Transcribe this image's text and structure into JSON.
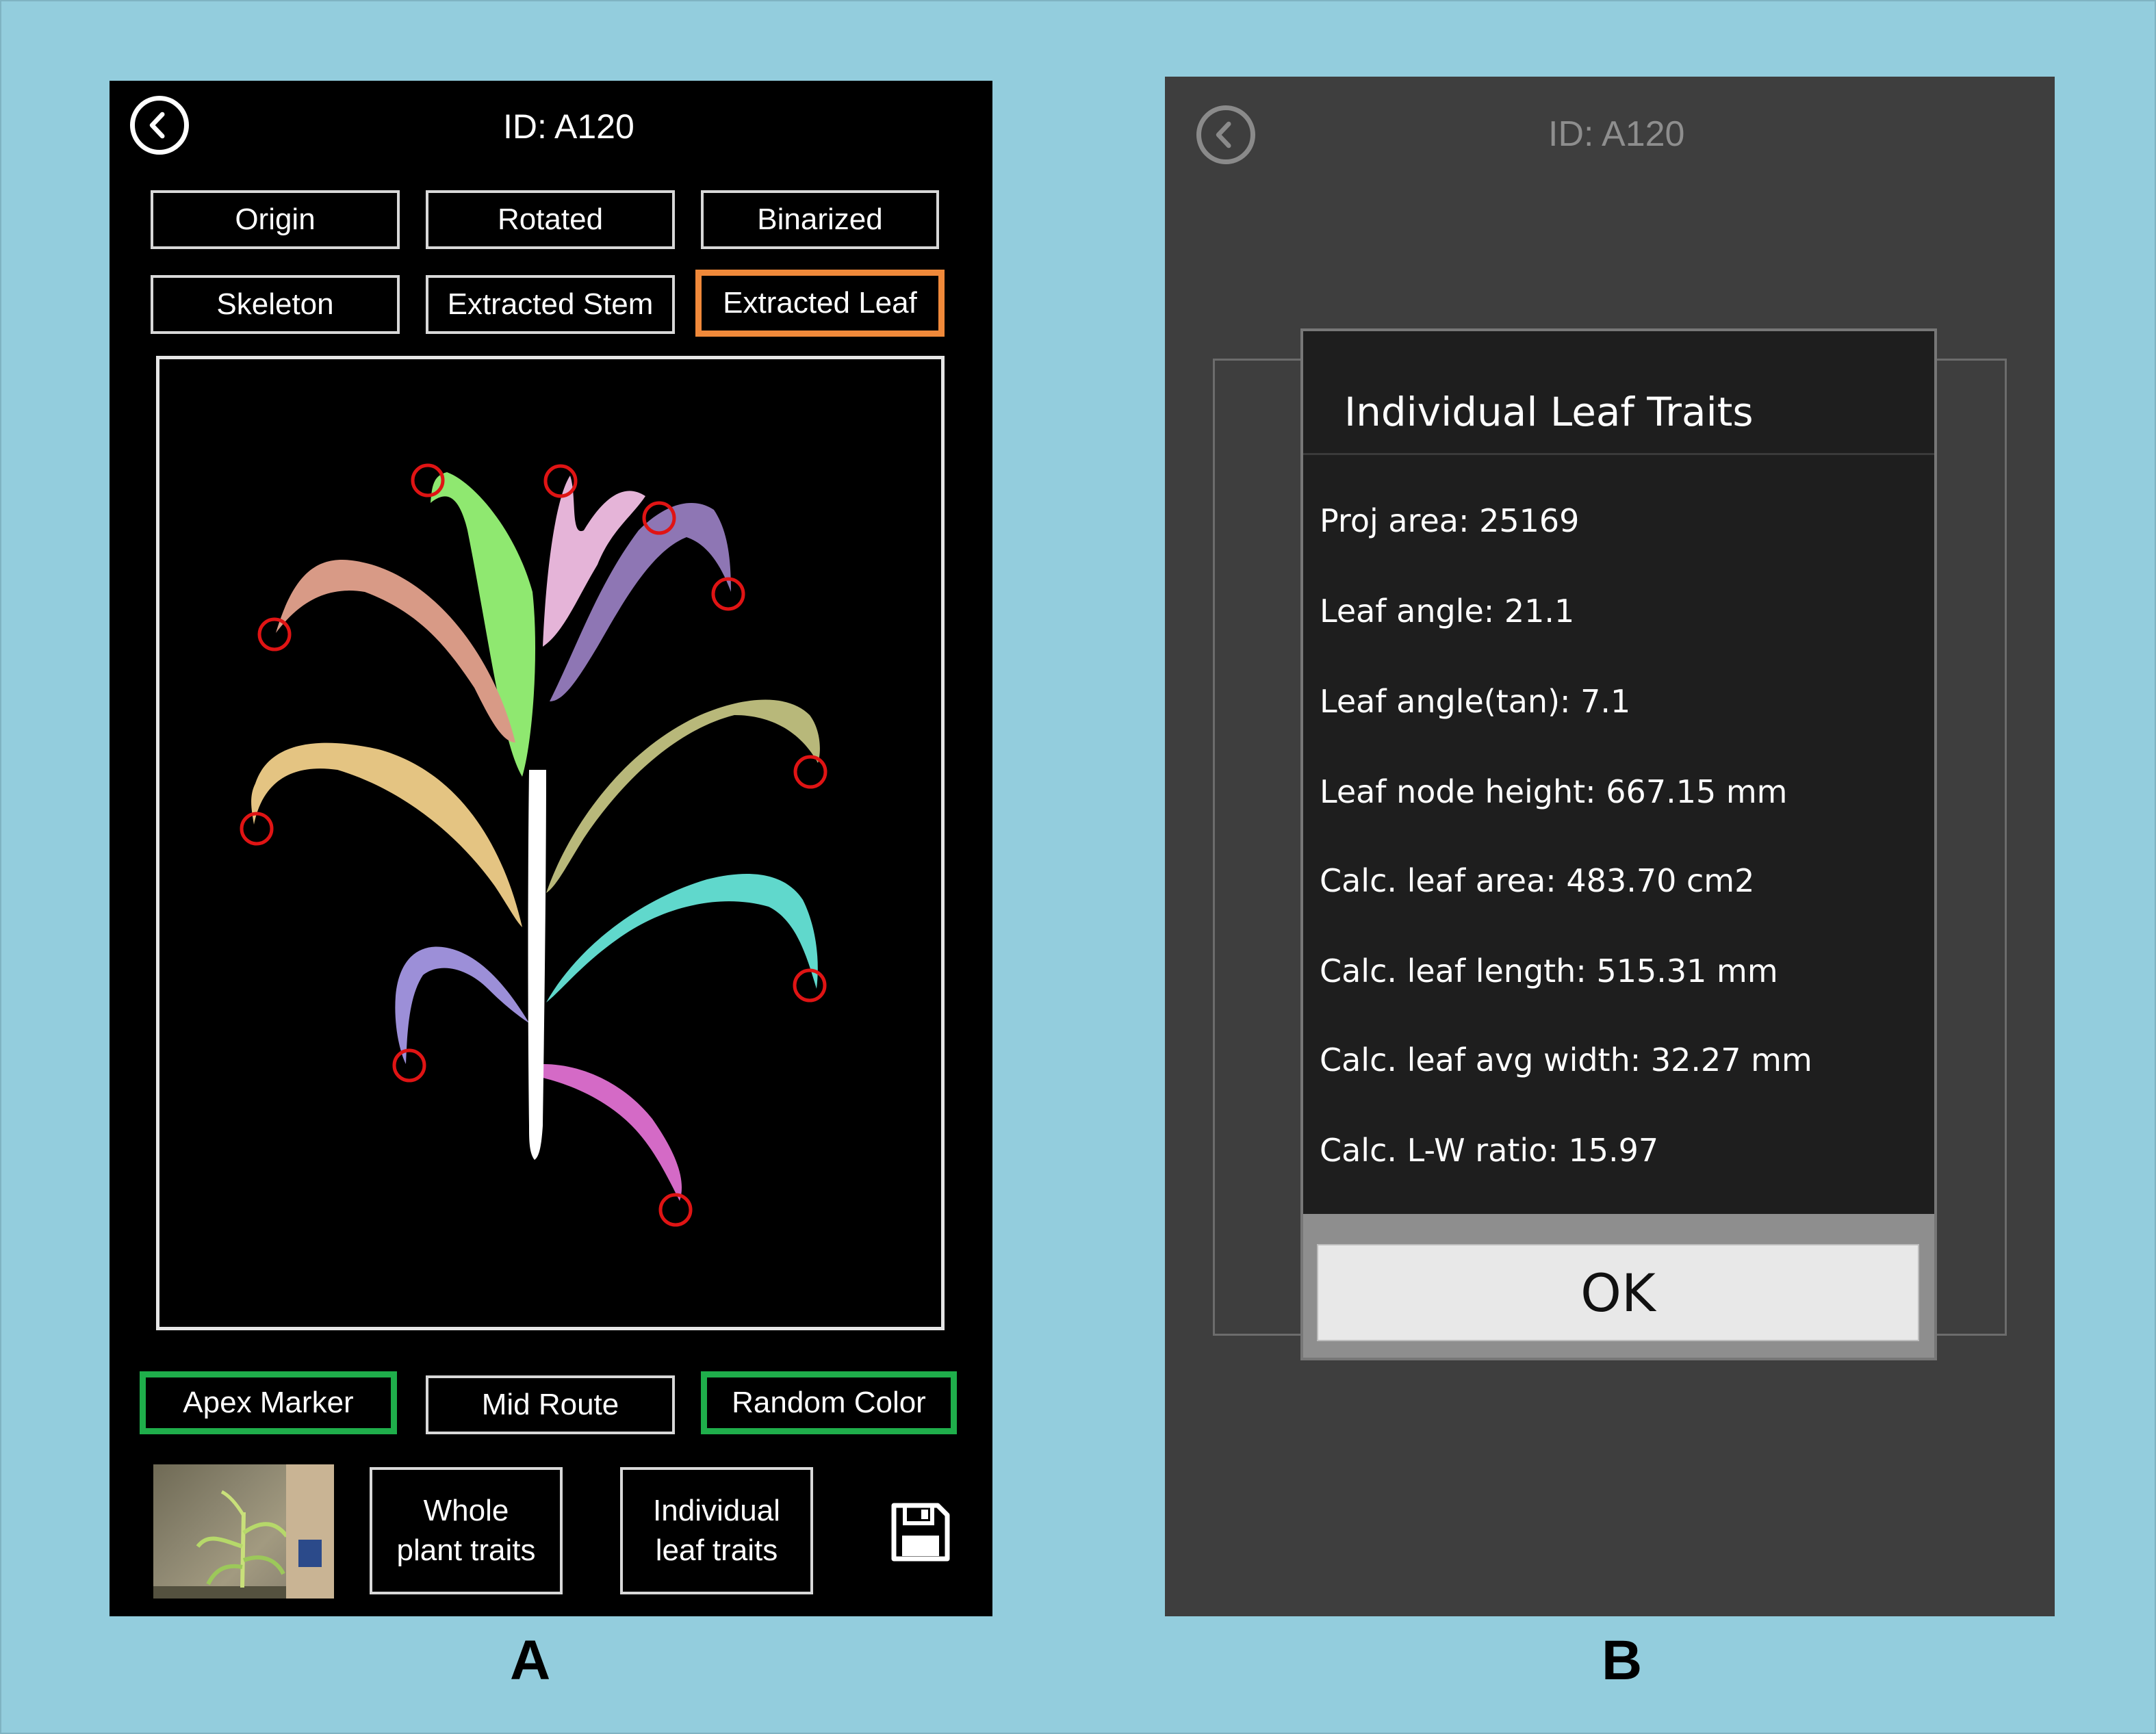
{
  "panel_a": {
    "panel_label": "A",
    "title": "ID: A120",
    "icons": {
      "back": "chevron-left-circle-icon",
      "save": "floppy-disk-icon"
    },
    "view_tabs": [
      {
        "label": "Origin",
        "state": "normal"
      },
      {
        "label": "Rotated",
        "state": "normal"
      },
      {
        "label": "Binarized",
        "state": "normal"
      },
      {
        "label": "Skeleton",
        "state": "normal"
      },
      {
        "label": "Extracted Stem",
        "state": "normal"
      },
      {
        "label": "Extracted Leaf",
        "state": "selected"
      }
    ],
    "display_toggles": [
      {
        "label": "Apex Marker",
        "state": "active"
      },
      {
        "label": "Mid Route",
        "state": "inactive"
      },
      {
        "label": "Random Color",
        "state": "active"
      }
    ],
    "actions": {
      "whole_plant_line1": "Whole",
      "whole_plant_line2": "plant traits",
      "individual_leaf_line1": "Individual",
      "individual_leaf_line2": "leaf traits"
    },
    "leaf_colors": [
      "#8fe870",
      "#d89a86",
      "#e5b4d8",
      "#8e76b4",
      "#e4c482",
      "#b8b87a",
      "#60d8cc",
      "#9c8fd8",
      "#d46ac6"
    ],
    "colors": {
      "selected_border": "#f0893a",
      "active_border": "#1fae4b",
      "apex_marker": "#e01414",
      "stem": "#ffffff"
    }
  },
  "panel_b": {
    "panel_label": "B",
    "title": "ID: A120",
    "dialog": {
      "title": "Individual Leaf Traits",
      "traits": [
        "Proj area: 25169",
        "Leaf angle: 21.1",
        "Leaf angle(tan): 7.1",
        "Leaf node height: 667.15 mm",
        "Calc. leaf area: 483.70 cm2",
        "Calc. leaf length: 515.31 mm",
        "Calc. leaf avg width: 32.27 mm",
        "Calc. L-W ratio: 15.97"
      ],
      "ok_label": "OK"
    }
  }
}
